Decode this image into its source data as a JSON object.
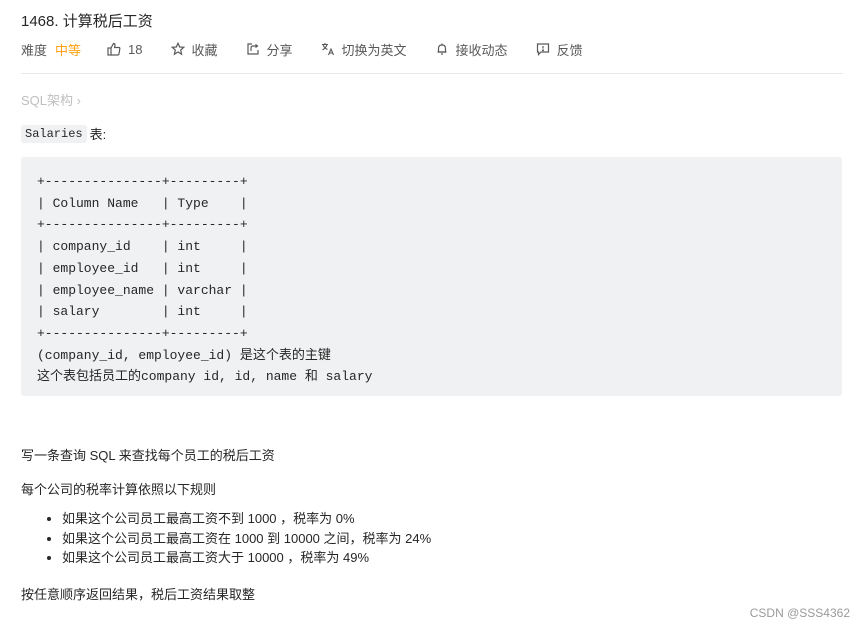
{
  "problem": {
    "title": "1468. 计算税后工资"
  },
  "meta": {
    "difficulty_label": "难度",
    "difficulty_value": "中等",
    "difficulty_color": "#ffa116",
    "likes": "18",
    "favorite_label": "收藏",
    "share_label": "分享",
    "translate_label": "切换为英文",
    "subscribe_label": "接收动态",
    "feedback_label": "反馈",
    "icons": {
      "likes": "thumbs-up-icon",
      "favorite": "star-icon",
      "share": "share-icon",
      "translate": "translate-icon",
      "subscribe": "bell-icon",
      "feedback": "feedback-icon"
    }
  },
  "breadcrumb": {
    "label": "SQL架构",
    "chevron": "›"
  },
  "table_intro": {
    "table_name": "Salaries",
    "suffix": "表:"
  },
  "schema_block": {
    "text": "+---------------+---------+\n| Column Name   | Type    |\n+---------------+---------+\n| company_id    | int     |\n| employee_id   | int     |\n| employee_name | varchar |\n| salary        | int     |\n+---------------+---------+\n(company_id, employee_id) 是这个表的主键\n这个表包括员工的company id, id, name 和 salary",
    "columns": [
      {
        "name": "company_id",
        "type": "int"
      },
      {
        "name": "employee_id",
        "type": "int"
      },
      {
        "name": "employee_name",
        "type": "varchar"
      },
      {
        "name": "salary",
        "type": "int"
      }
    ]
  },
  "description": {
    "para1": "写一条查询 SQL 来查找每个员工的税后工资",
    "para2": "每个公司的税率计算依照以下规则",
    "rules": [
      "如果这个公司员工最高工资不到 1000 ，税率为 0%",
      "如果这个公司员工最高工资在 1000 到 10000 之间，税率为 24%",
      "如果这个公司员工最高工资大于 10000 ，税率为 49%"
    ],
    "para3": "按任意顺序返回结果，税后工资结果取整"
  },
  "watermark": "CSDN @SSS4362"
}
